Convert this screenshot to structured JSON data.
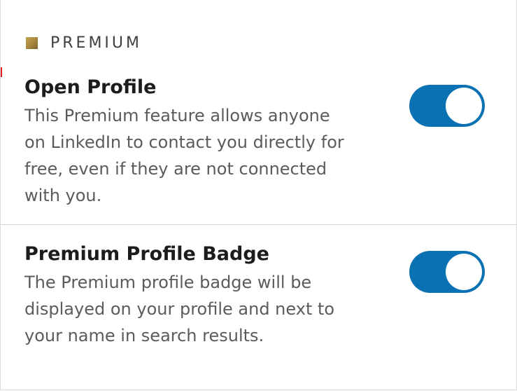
{
  "section": {
    "icon": "premium-square-icon",
    "label": "PREMIUM"
  },
  "settings": [
    {
      "title": "Open Profile",
      "description_lines": [
        "This Premium feature allows anyone",
        "on LinkedIn to contact you directly for",
        "free, even if they are not connected",
        "with you."
      ],
      "enabled": true
    },
    {
      "title": "Premium Profile Badge",
      "description_lines": [
        "The Premium profile badge will be",
        "displayed on your profile and next to",
        "your name in search results."
      ],
      "enabled": true
    }
  ],
  "colors": {
    "toggle_on": "#0a72b2",
    "premium_gold": "#b0914a"
  }
}
